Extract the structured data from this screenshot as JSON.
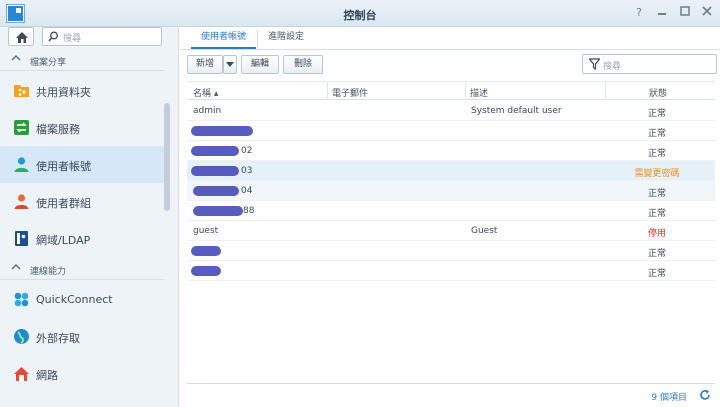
{
  "window": {
    "title": "控制台"
  },
  "sidebar": {
    "search_placeholder": "搜尋",
    "sections": [
      {
        "label": "檔案分享"
      },
      {
        "label": "連線能力"
      }
    ],
    "items": [
      {
        "label": "共用資料夾",
        "icon": "shared-folder-icon"
      },
      {
        "label": "檔案服務",
        "icon": "file-services-icon"
      },
      {
        "label": "使用者帳號",
        "icon": "user-icon",
        "active": true
      },
      {
        "label": "使用者群組",
        "icon": "group-icon"
      },
      {
        "label": "網域/LDAP",
        "icon": "domain-ldap-icon"
      },
      {
        "label": "QuickConnect",
        "icon": "quickconnect-icon"
      },
      {
        "label": "外部存取",
        "icon": "external-access-icon"
      },
      {
        "label": "網路",
        "icon": "network-icon"
      }
    ]
  },
  "tabs": [
    {
      "label": "使用者帳號",
      "active": true
    },
    {
      "label": "進階設定",
      "active": false
    }
  ],
  "toolbar": {
    "create_label": "新增",
    "edit_label": "編輯",
    "delete_label": "刪除",
    "filter_placeholder": "搜尋"
  },
  "table": {
    "columns": {
      "name": "名稱 ▴",
      "email": "電子郵件",
      "description": "描述",
      "status": "狀態"
    },
    "rows": [
      {
        "name": "admin",
        "description": "System default user",
        "status": "正常",
        "status_color": "#3a4a5a"
      },
      {
        "name": "",
        "description": "",
        "status": "正常",
        "status_color": "#3a4a5a"
      },
      {
        "name": "02",
        "description": "",
        "status": "正常",
        "status_color": "#3a4a5a"
      },
      {
        "name": "03",
        "description": "",
        "status": "需變更密碼",
        "status_color": "#e8901a"
      },
      {
        "name": "04",
        "description": "",
        "status": "正常",
        "status_color": "#3a4a5a"
      },
      {
        "name": "88",
        "description": "",
        "status": "正常",
        "status_color": "#3a4a5a"
      },
      {
        "name": "guest",
        "description": "Guest",
        "status": "停用",
        "status_color": "#d9342b"
      },
      {
        "name": "",
        "description": "",
        "status": "正常",
        "status_color": "#3a4a5a"
      },
      {
        "name": "",
        "description": "",
        "status": "正常",
        "status_color": "#3a4a5a"
      }
    ]
  },
  "footer": {
    "count": "9 個項目"
  },
  "colors": {
    "accent": "#2c7bc6",
    "warning": "#e8901a",
    "disabled": "#d9342b"
  }
}
